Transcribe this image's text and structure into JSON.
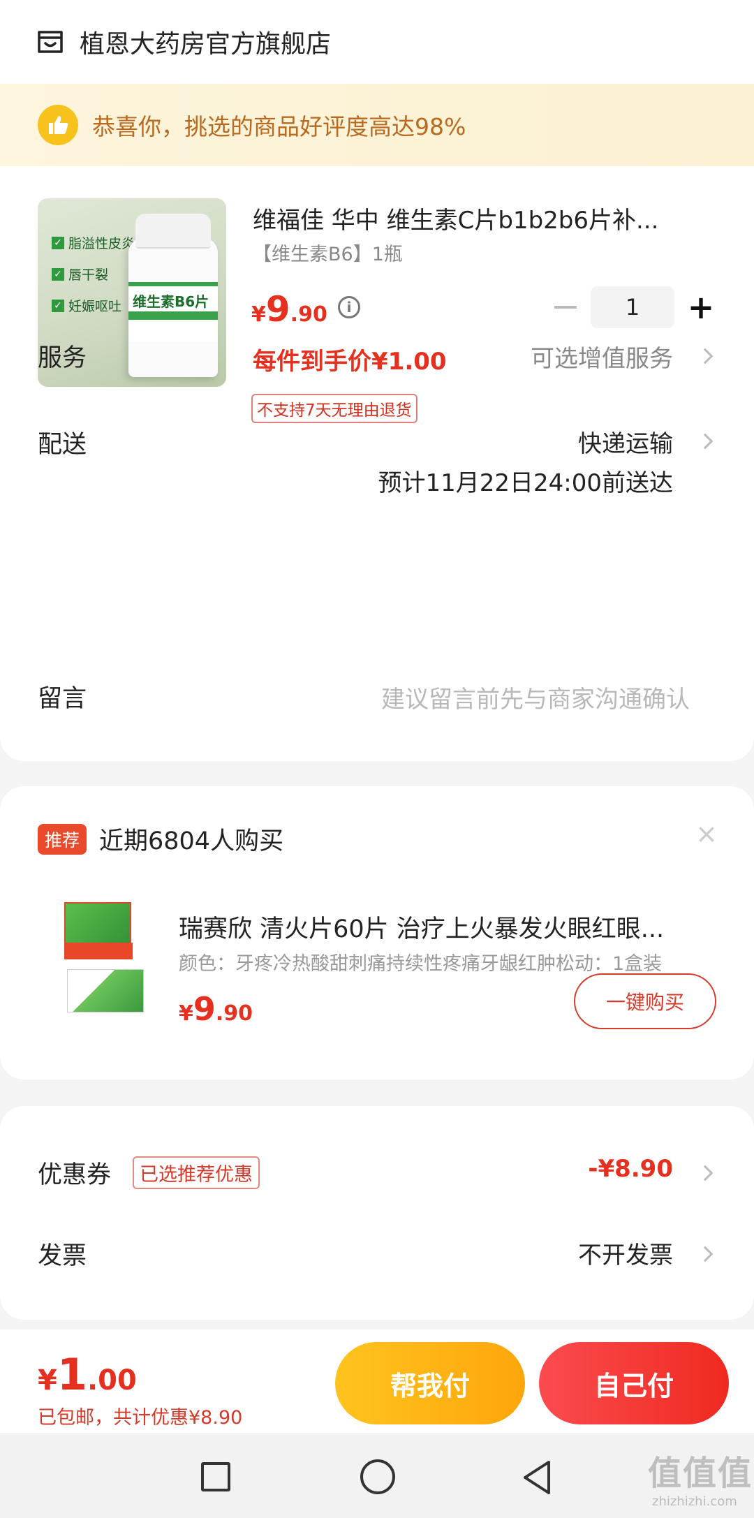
{
  "store": {
    "name": "植恩大药房官方旗舰店",
    "icon": "store-icon"
  },
  "praise": {
    "text": "恭喜你，挑选的商品好评度高达98%",
    "icon": "thumbs-up-icon"
  },
  "product": {
    "title": "维福佳 华中 维生素C片b1b2b6片补...",
    "spec": "【维生素B6】1瓶",
    "image": {
      "features": [
        "脂溢性皮炎",
        "唇干裂",
        "妊娠呕吐"
      ],
      "bottle_label": "维生素B6片"
    },
    "price_symbol": "¥",
    "price_int": "9",
    "price_dec": ".90",
    "quantity": "1",
    "unit_price": "每件到手价¥1.00",
    "no_return": "不支持7天无理由退货"
  },
  "rows": {
    "service": {
      "label": "服务",
      "value": "可选增值服务"
    },
    "delivery": {
      "label": "配送",
      "value": "快递运输",
      "eta": "预计11月22日24:00前送达"
    },
    "message": {
      "label": "留言",
      "placeholder": "建议留言前先与商家沟通确认"
    }
  },
  "recommend": {
    "tag": "推荐",
    "title": "近期6804人购买",
    "close": "×",
    "item": {
      "name": "瑞赛欣 清火片60片 治疗上火暴发火眼红眼...",
      "spec": "颜色：牙疼冷热酸甜刺痛持续性疼痛牙龈红肿松动：1盒装",
      "price_symbol": "¥",
      "price_int": "9",
      "price_dec": ".90",
      "buy_label": "一键购买"
    }
  },
  "coupon": {
    "label": "优惠券",
    "badge": "已选推荐优惠",
    "value": "-¥8.90"
  },
  "invoice": {
    "label": "发票",
    "value": "不开发票"
  },
  "footer": {
    "total_symbol": "¥",
    "total_int": "1",
    "total_dec": ".00",
    "note": "已包邮，共计优惠¥8.90",
    "help_pay": "帮我付",
    "self_pay": "自己付"
  },
  "colors": {
    "accent_red": "#e5301f",
    "help_yellow": "#fea60c",
    "self_red": "#ef2a20"
  },
  "watermark": {
    "text": "值值值",
    "sub": "zhizhizhi.com"
  }
}
